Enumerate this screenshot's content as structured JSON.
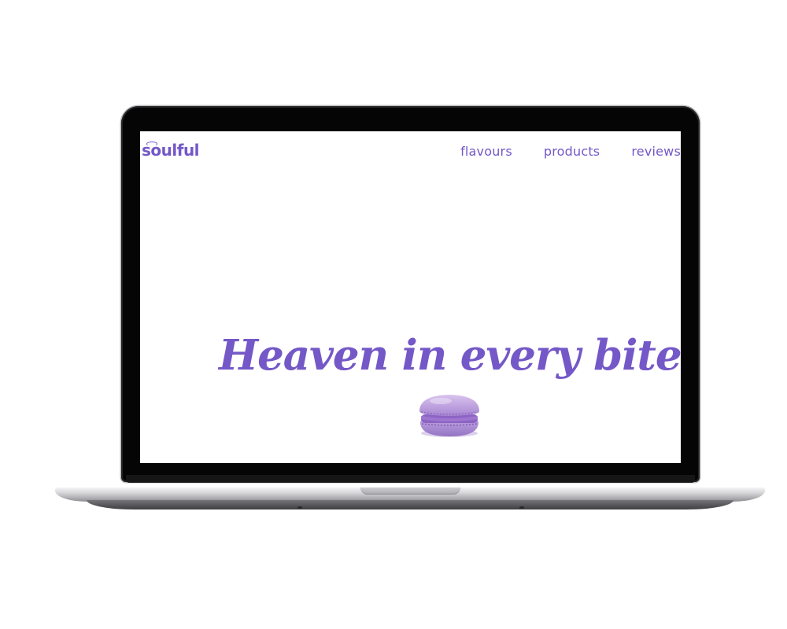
{
  "site": {
    "logo_text": "soulful",
    "nav": [
      {
        "label": "flavours"
      },
      {
        "label": "products"
      },
      {
        "label": "reviews"
      }
    ],
    "hero_title": "Heaven in every bite."
  },
  "colors": {
    "brand_purple": "#7458c7",
    "macaron_lavender": "#b79ad9",
    "bezel": "#050505"
  },
  "icons": {
    "logo_mark": "halo-icon",
    "hero_image": "macaron-icon"
  }
}
